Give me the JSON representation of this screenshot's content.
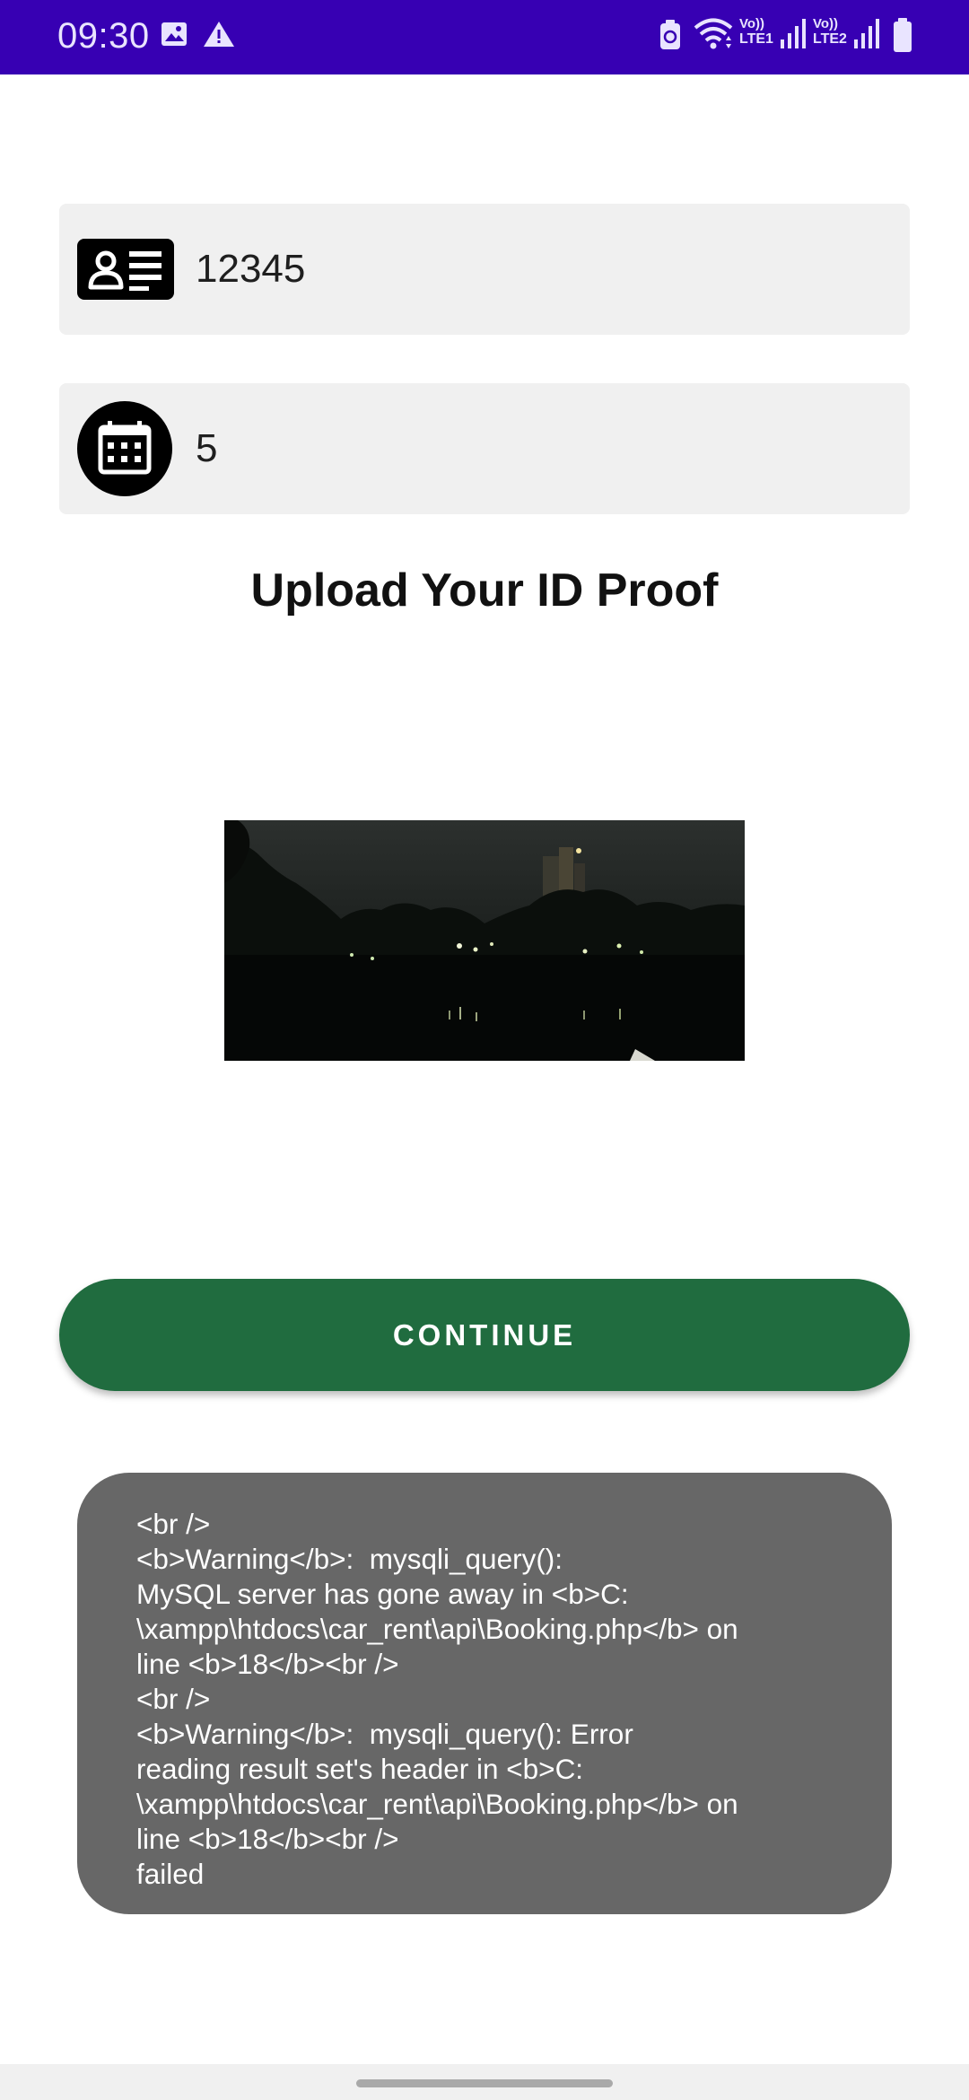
{
  "status_bar": {
    "time": "09:30",
    "left_icons": [
      "image-icon",
      "warning-icon"
    ],
    "right_icons": [
      "battery-saver-icon",
      "wifi-icon",
      "signal-lte1-icon",
      "signal-lte2-icon",
      "battery-icon"
    ],
    "lte1_label_top": "Vo))",
    "lte1_label_bottom": "LTE1",
    "lte2_label_top": "Vo))",
    "lte2_label_bottom": "LTE2",
    "background": "#3700b3"
  },
  "form": {
    "id_field": {
      "icon": "id-card-icon",
      "value": "12345"
    },
    "days_field": {
      "icon": "calendar-icon",
      "value": "5"
    }
  },
  "upload": {
    "heading": "Upload Your ID Proof"
  },
  "continue_button": {
    "label": "CONTINUE",
    "color": "#206c3f"
  },
  "toast": {
    "message": "<br />\n<b>Warning</b>:  mysqli_query():\nMySQL server has gone away in <b>C:\n\\xampp\\htdocs\\car_rent\\api\\Booking.php</b> on\nline <b>18</b><br />\n<br />\n<b>Warning</b>:  mysqli_query(): Error\nreading result set's header in <b>C:\n\\xampp\\htdocs\\car_rent\\api\\Booking.php</b> on\nline <b>18</b><br />\nfailed"
  }
}
